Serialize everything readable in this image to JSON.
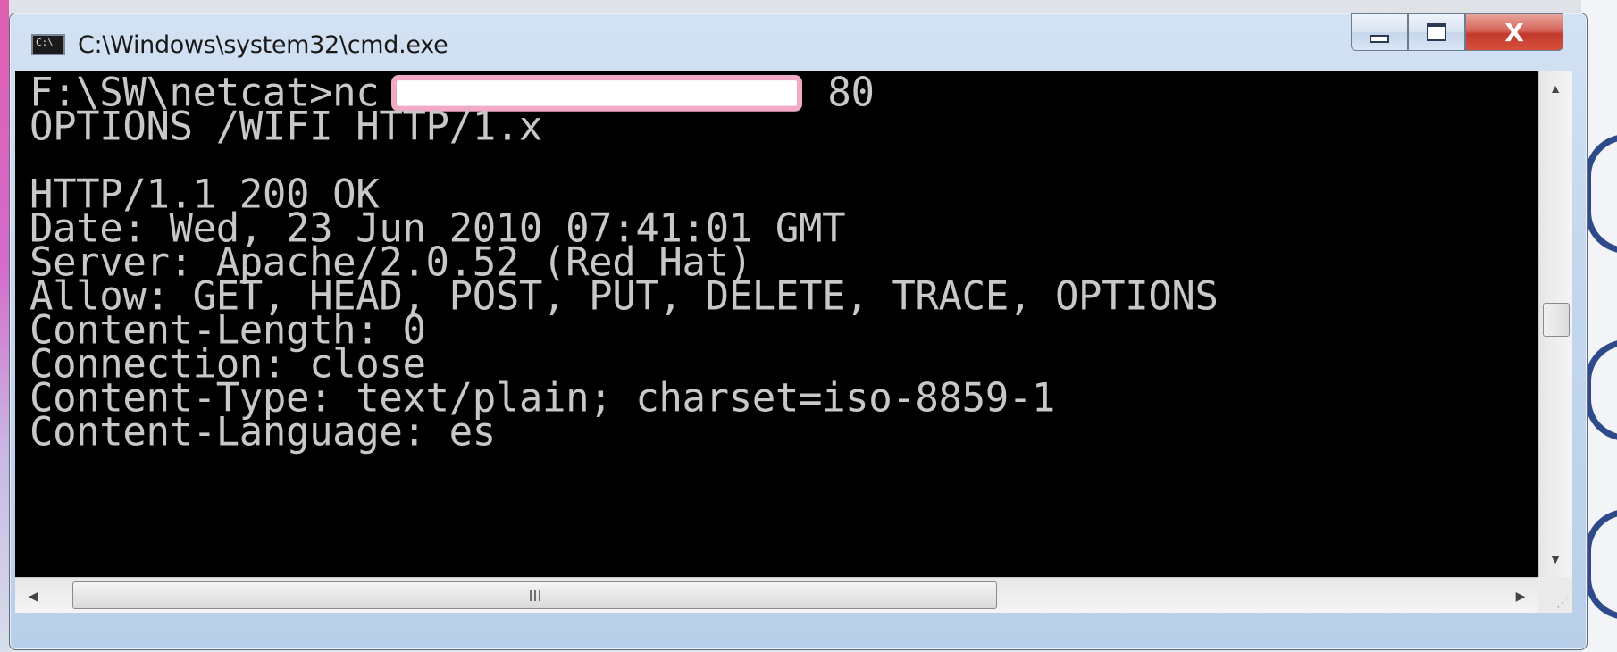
{
  "window": {
    "title": "C:\\Windows\\system32\\cmd.exe",
    "icon": "cmd-console-icon",
    "controls": {
      "minimize_icon": "minimize-icon",
      "maximize_icon": "maximize-icon",
      "close_label": "X"
    }
  },
  "console": {
    "lines": [
      {
        "text_before": "F:\\SW\\netcat>nc",
        "redacted": true,
        "text_after": "80"
      },
      {
        "text": "OPTIONS /WIFI HTTP/1.x"
      },
      {
        "text": ""
      },
      {
        "text": "HTTP/1.1 200 OK"
      },
      {
        "text": "Date: Wed, 23 Jun 2010 07:41:01 GMT"
      },
      {
        "text": "Server: Apache/2.0.52 (Red Hat)"
      },
      {
        "text": "Allow: GET, HEAD, POST, PUT, DELETE, TRACE, OPTIONS"
      },
      {
        "text": "Content-Length: 0"
      },
      {
        "text": "Connection: close"
      },
      {
        "text": "Content-Type: text/plain; charset=iso-8859-1"
      },
      {
        "text": "Content-Language: es"
      }
    ]
  },
  "scrollbars": {
    "vertical": {
      "up_icon": "scroll-up-arrow-icon",
      "down_icon": "scroll-down-arrow-icon",
      "position": 0.46
    },
    "horizontal": {
      "left_icon": "scroll-left-arrow-icon",
      "right_icon": "scroll-right-arrow-icon",
      "position": 0.0,
      "visible_fraction": 0.63
    }
  },
  "colors": {
    "console_bg": "#000000",
    "console_text": "#c8c8c8",
    "redaction_border": "#f2a9c5",
    "close_button": "#c2392c"
  }
}
